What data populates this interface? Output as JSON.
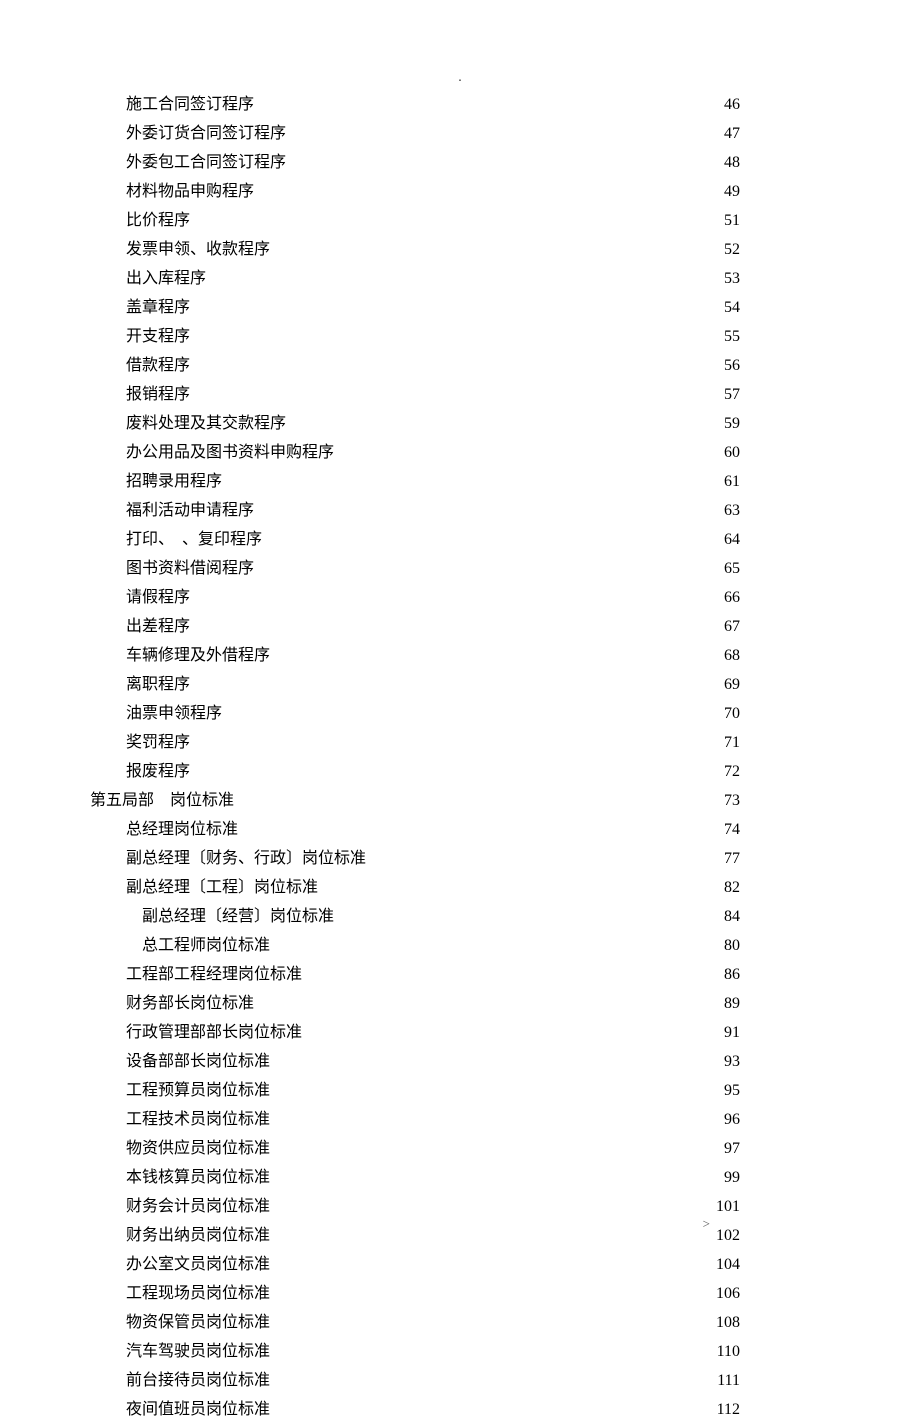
{
  "top_marker": ".",
  "footer_left": ".",
  "footer_right": ">",
  "entries": [
    {
      "label": "施工合同签订程序",
      "page": "46",
      "indent": 1
    },
    {
      "label": "外委订货合同签订程序",
      "page": "47",
      "indent": 1
    },
    {
      "label": "外委包工合同签订程序",
      "page": "48",
      "indent": 1
    },
    {
      "label": "材料物品申购程序",
      "page": "49",
      "indent": 1
    },
    {
      "label": "比价程序",
      "page": "51",
      "indent": 1
    },
    {
      "label": "发票申领、收款程序",
      "page": "52",
      "indent": 1
    },
    {
      "label": "出入库程序",
      "page": "53",
      "indent": 1
    },
    {
      "label": "盖章程序",
      "page": "54",
      "indent": 1
    },
    {
      "label": "开支程序",
      "page": "55",
      "indent": 1
    },
    {
      "label": "借款程序",
      "page": "56",
      "indent": 1
    },
    {
      "label": "报销程序",
      "page": "57",
      "indent": 1
    },
    {
      "label": "废料处理及其交款程序",
      "page": "59",
      "indent": 1
    },
    {
      "label": "办公用品及图书资料申购程序",
      "page": "60",
      "indent": 1
    },
    {
      "label": "招聘录用程序",
      "page": "61",
      "indent": 1
    },
    {
      "label": "福利活动申请程序",
      "page": "63",
      "indent": 1
    },
    {
      "label": "打印、　、复印程序",
      "page": "64",
      "indent": 1
    },
    {
      "label": "图书资料借阅程序",
      "page": "65",
      "indent": 1
    },
    {
      "label": "请假程序",
      "page": "66",
      "indent": 1
    },
    {
      "label": "出差程序",
      "page": "67",
      "indent": 1
    },
    {
      "label": "车辆修理及外借程序",
      "page": "68",
      "indent": 1
    },
    {
      "label": "离职程序",
      "page": "69",
      "indent": 1
    },
    {
      "label": "油票申领程序",
      "page": "70",
      "indent": 1
    },
    {
      "label": "奖罚程序",
      "page": "71",
      "indent": 1
    },
    {
      "label": "报废程序",
      "page": "72",
      "indent": 1
    },
    {
      "label": "第五局部　岗位标准",
      "page": "73",
      "indent": 0
    },
    {
      "label": "总经理岗位标准",
      "page": "74",
      "indent": 1
    },
    {
      "label": "副总经理〔财务、行政〕岗位标准",
      "page": "77",
      "indent": 1
    },
    {
      "label": "副总经理〔工程〕岗位标准",
      "page": "82",
      "indent": 1
    },
    {
      "label": "副总经理〔经营〕岗位标准",
      "page": "84",
      "indent": 2
    },
    {
      "label": "总工程师岗位标准",
      "page": "80",
      "indent": 2
    },
    {
      "label": "工程部工程经理岗位标准",
      "page": "86",
      "indent": 1
    },
    {
      "label": "财务部长岗位标准",
      "page": "89",
      "indent": 1
    },
    {
      "label": "行政管理部部长岗位标准",
      "page": "91",
      "indent": 1
    },
    {
      "label": "设备部部长岗位标准",
      "page": "93",
      "indent": 1
    },
    {
      "label": "工程预算员岗位标准",
      "page": "95",
      "indent": 1
    },
    {
      "label": "工程技术员岗位标准",
      "page": "96",
      "indent": 1
    },
    {
      "label": "物资供应员岗位标准",
      "page": "97",
      "indent": 1
    },
    {
      "label": "本钱核算员岗位标准",
      "page": "99",
      "indent": 1
    },
    {
      "label": "财务会计员岗位标准",
      "page": "101",
      "indent": 1
    },
    {
      "label": "财务出纳员岗位标准",
      "page": "102",
      "indent": 1
    },
    {
      "label": "办公室文员岗位标准",
      "page": "104",
      "indent": 1
    },
    {
      "label": "工程现场员岗位标准",
      "page": "106",
      "indent": 1
    },
    {
      "label": "物资保管员岗位标准",
      "page": "108",
      "indent": 1
    },
    {
      "label": "汽车驾驶员岗位标准",
      "page": "110",
      "indent": 1
    },
    {
      "label": "前台接待员岗位标准",
      "page": "111",
      "indent": 1
    },
    {
      "label": "夜间值班员岗位标准",
      "page": "112",
      "indent": 1
    }
  ]
}
